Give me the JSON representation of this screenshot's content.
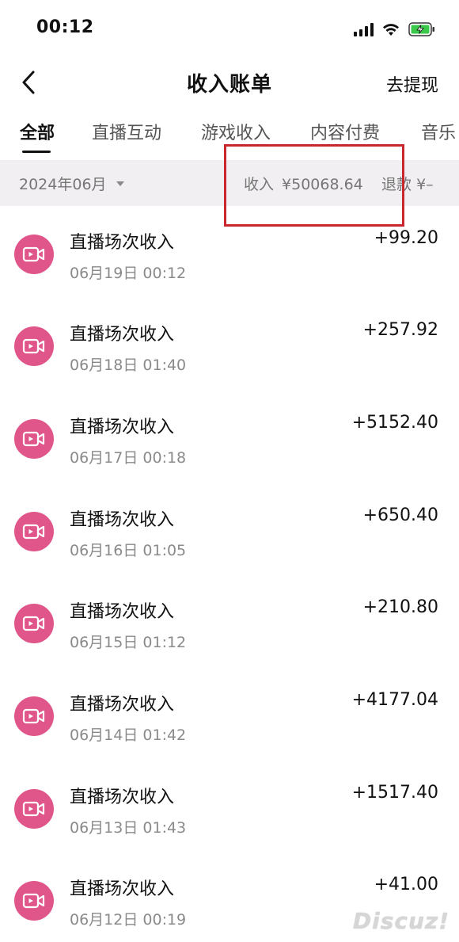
{
  "status_bar": {
    "time": "00:12",
    "icons": [
      "signal-icon",
      "wifi-icon",
      "battery-charging-icon"
    ],
    "battery_color": "#3cc84a"
  },
  "nav": {
    "back_icon": "chevron-left-icon",
    "title": "收入账单",
    "action": "去提现"
  },
  "tabs": [
    {
      "label": "全部",
      "active": true
    },
    {
      "label": "直播互动",
      "active": false
    },
    {
      "label": "游戏收入",
      "active": false
    },
    {
      "label": "内容付费",
      "active": false
    },
    {
      "label": "音乐",
      "active": false
    }
  ],
  "summary": {
    "month": "2024年06月",
    "income_label": "收入",
    "income_value": "¥50068.64",
    "refund_label": "退款",
    "refund_value": "¥–",
    "highlight_color": "#c8272d"
  },
  "transactions": [
    {
      "title": "直播场次收入",
      "time": "06月19日 00:12",
      "amount": "+99.20"
    },
    {
      "title": "直播场次收入",
      "time": "06月18日 01:40",
      "amount": "+257.92"
    },
    {
      "title": "直播场次收入",
      "time": "06月17日 00:18",
      "amount": "+5152.40"
    },
    {
      "title": "直播场次收入",
      "time": "06月16日 01:05",
      "amount": "+650.40"
    },
    {
      "title": "直播场次收入",
      "time": "06月15日 01:12",
      "amount": "+210.80"
    },
    {
      "title": "直播场次收入",
      "time": "06月14日 01:42",
      "amount": "+4177.04"
    },
    {
      "title": "直播场次收入",
      "time": "06月13日 01:43",
      "amount": "+1517.40"
    },
    {
      "title": "直播场次收入",
      "time": "06月12日 00:19",
      "amount": "+41.00"
    }
  ],
  "item_icon": "live-video-icon",
  "item_icon_color": "#e0568a",
  "watermark": "Discuz!"
}
